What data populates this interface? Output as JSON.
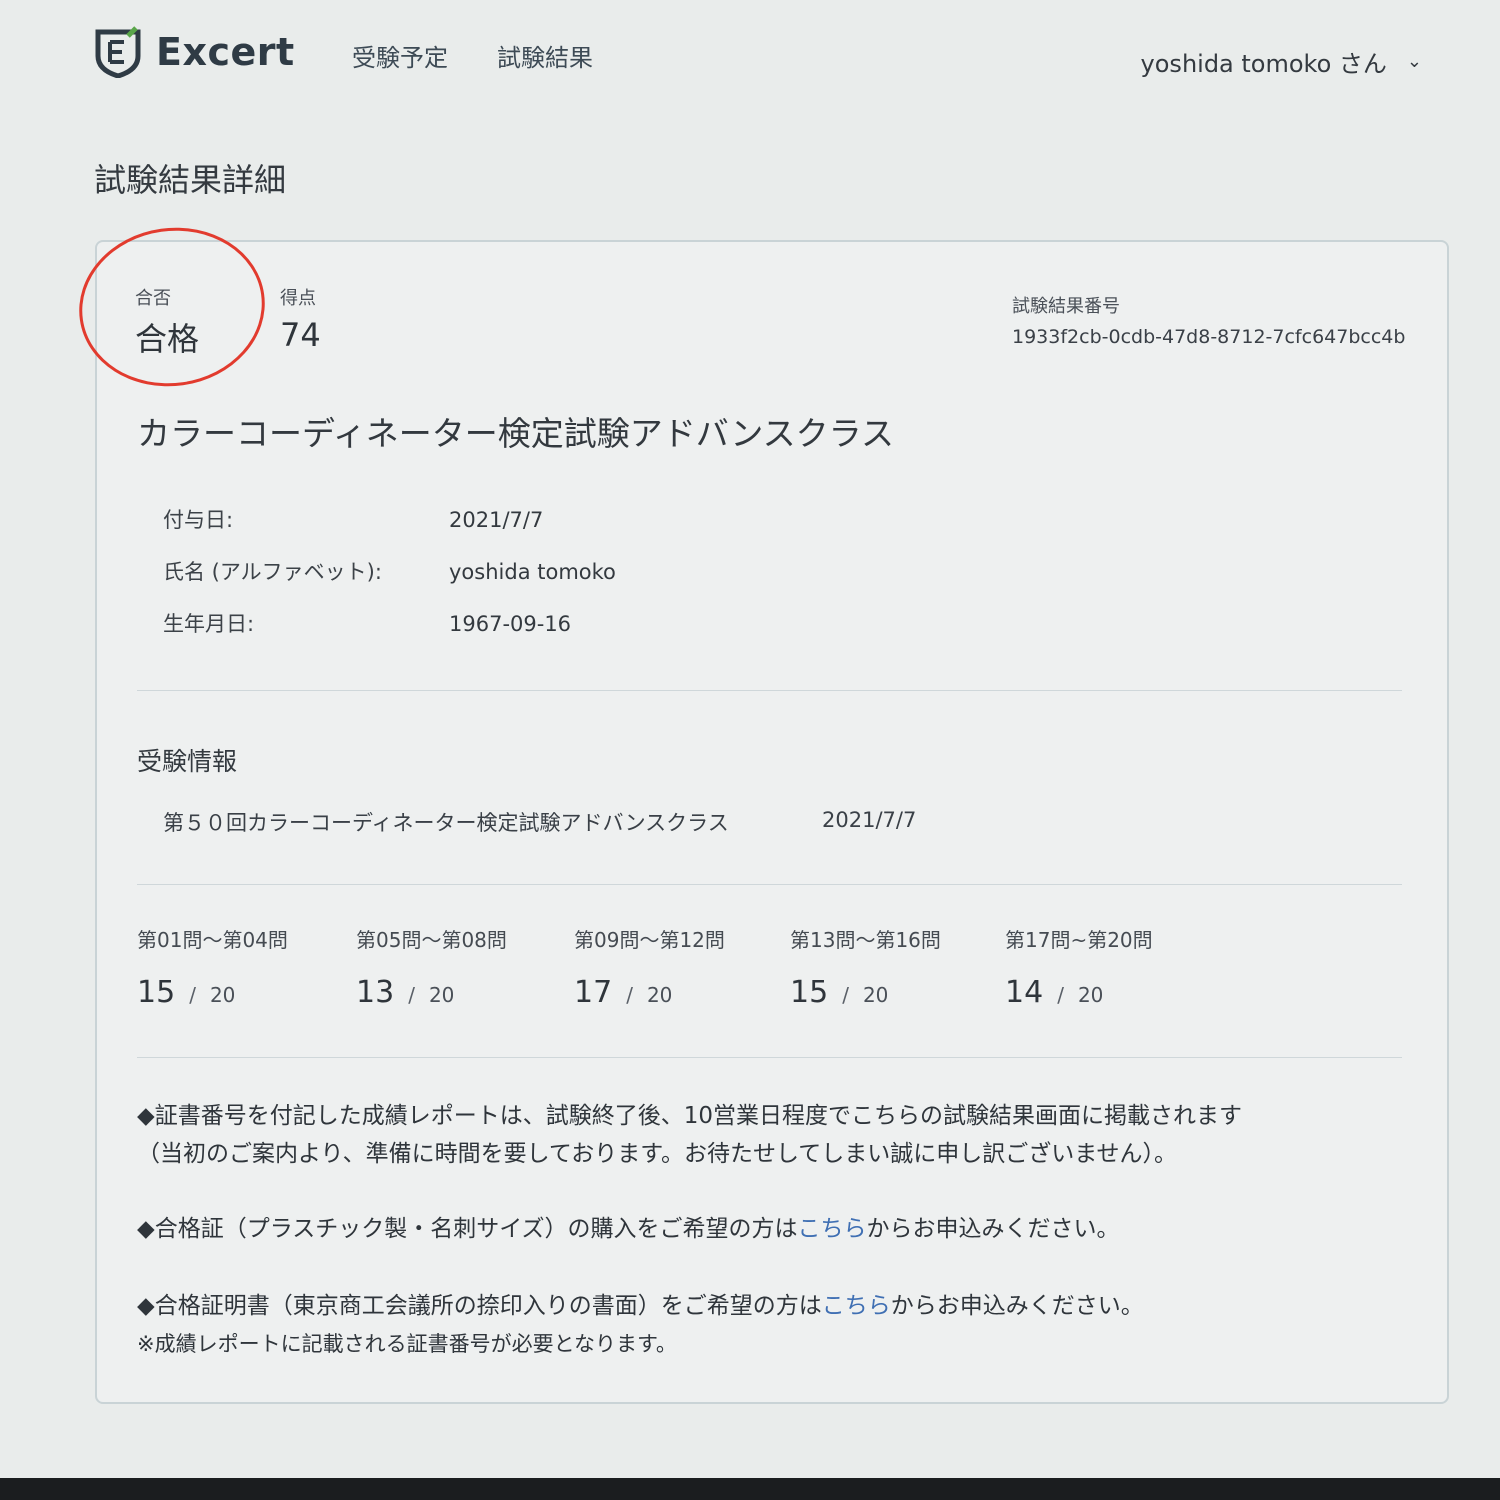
{
  "header": {
    "brand": "Excert",
    "nav": [
      "受験予定",
      "試験結果"
    ],
    "user": "yoshida tomoko さん"
  },
  "page_title": "試験結果詳細",
  "summary": {
    "pass_label": "合否",
    "pass_value": "合格",
    "score_label": "得点",
    "score_value": "74",
    "result_id_label": "試験結果番号",
    "result_id": "1933f2cb-0cdb-47d8-8712-7cfc647bcc4b"
  },
  "exam_title": "カラーコーディネーター検定試験アドバンスクラス",
  "info": [
    {
      "label": "付与日:",
      "value": "2021/7/7"
    },
    {
      "label": "氏名 (アルファベット):",
      "value": "yoshida tomoko"
    },
    {
      "label": "生年月日:",
      "value": "1967-09-16"
    }
  ],
  "exam_info": {
    "heading": "受験情報",
    "session": "第５０回カラーコーディネーター検定試験アドバンスクラス",
    "date": "2021/7/7"
  },
  "scores": [
    {
      "label": "第01問〜第04問",
      "score": "15",
      "sep": "/",
      "total": "20"
    },
    {
      "label": "第05問〜第08問",
      "score": "13",
      "sep": "/",
      "total": "20"
    },
    {
      "label": "第09問〜第12問",
      "score": "17",
      "sep": "/",
      "total": "20"
    },
    {
      "label": "第13問〜第16問",
      "score": "15",
      "sep": "/",
      "total": "20"
    },
    {
      "label": "第17問~第20問",
      "score": "14",
      "sep": "/",
      "total": "20"
    }
  ],
  "notes": {
    "n1_line1": "◆証書番号を付記した成績レポートは、試験終了後、10営業日程度でこちらの試験結果画面に掲載されます",
    "n1_line2": "（当初のご案内より、準備に時間を要しております。お待たせしてしまい誠に申し訳ございません）。",
    "n2_pre": "◆合格証（プラスチック製・名刺サイズ）の購入をご希望の方は",
    "n2_link": "こちら",
    "n2_post": "からお申込みください。",
    "n3_pre": "◆合格証明書（東京商工会議所の捺印入りの書面）をご希望の方は",
    "n3_link": "こちら",
    "n3_post": "からお申込みください。",
    "n3_line2": "※成績レポートに記載される証書番号が必要となります。"
  },
  "colors": {
    "brand_green": "#5aa64a",
    "brand_dark": "#2f3b45",
    "link": "#3f6fb3",
    "annotation_red": "#e23b2e"
  }
}
